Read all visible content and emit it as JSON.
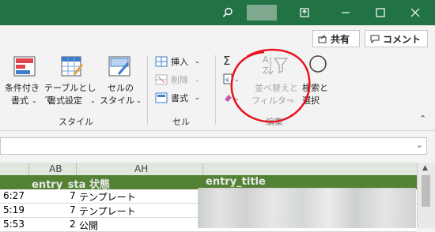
{
  "titlebar": {
    "search_icon": "search-icon",
    "restore_icon": "ribbon-display-icon",
    "min_icon": "minimize-icon",
    "max_icon": "maximize-icon",
    "close_icon": "close-icon"
  },
  "top_buttons": {
    "share": "共有",
    "comment": "コメント"
  },
  "style_group": {
    "conditional_line1": "条件付き",
    "conditional_line2": "書式",
    "table_line1": "テーブルとして",
    "table_line2": "書式設定",
    "cell_style_line1": "セルの",
    "cell_style_line2": "スタイル",
    "label": "スタイル"
  },
  "cells_group": {
    "insert": "挿入",
    "delete": "削除",
    "format": "書式",
    "label": "セル"
  },
  "edit_group": {
    "sort_line1": "並べ替えと",
    "sort_line2": "フィルター",
    "find_line1": "検索と",
    "find_line2": "選択",
    "label": "編集"
  },
  "grid": {
    "col_ab": "AB",
    "col_ah": "AH",
    "header_entry_sta": "entry_sta 状態",
    "header_entry_title": "entry_title",
    "rows": [
      {
        "time": "6:27",
        "num": "7",
        "status": "テンプレート"
      },
      {
        "time": "5:19",
        "num": "7",
        "status": "テンプレート"
      },
      {
        "time": "5:53",
        "num": "2",
        "status": "公開"
      }
    ]
  },
  "colors": {
    "excel_green": "#217346",
    "header_green": "#548235",
    "annotation_red": "#e8141e"
  }
}
